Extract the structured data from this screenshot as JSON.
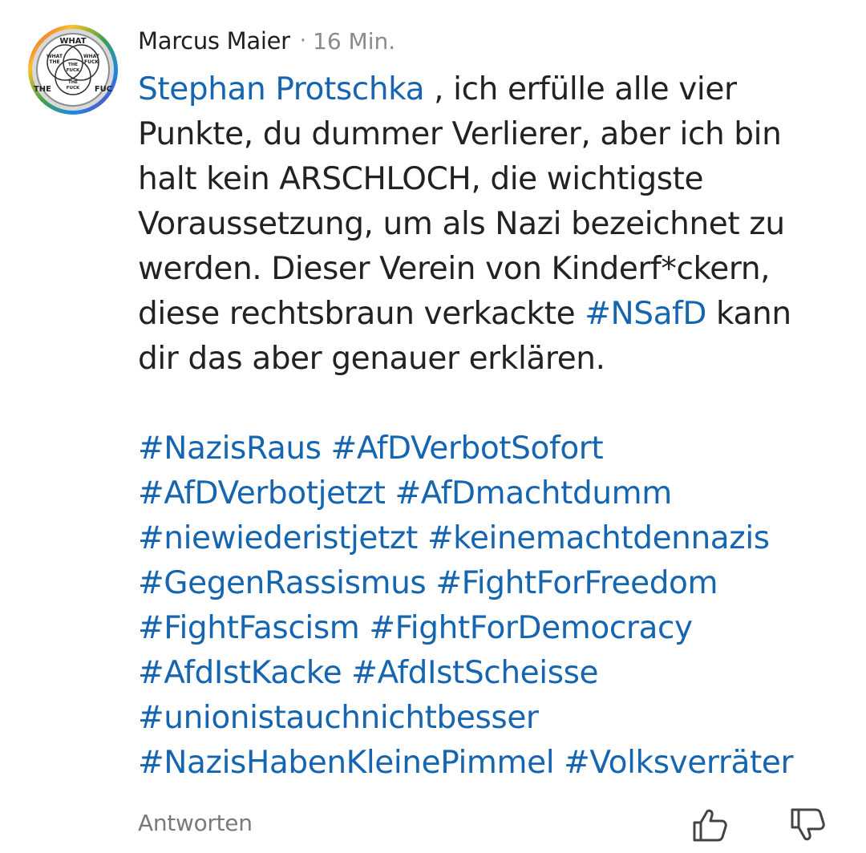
{
  "comment": {
    "author": "Marcus Maier",
    "separator": "·",
    "time": "16 Min.",
    "avatar": {
      "icon": "venn-diagram-avatar",
      "words": [
        "WHAT",
        "WHAT",
        "WHAT",
        "THE",
        "FUCK",
        "THE",
        "FUCK",
        "THE",
        "FUCK",
        "THE",
        "FUC"
      ]
    },
    "mention": "Stephan Protschka",
    "lines": [
      " , ich erfülle alle vier",
      "Punkte, du dummer Verlierer, aber ich bin",
      "halt kein ARSCHLOCH, die wichtigste",
      "Voraussetzung, um als Nazi bezeichnet zu",
      "werden. Dieser Verein von Kinderf*ckern,"
    ],
    "line6_pre": "diese rechtsbraun verkackte ",
    "line6_tag": "#NSafD",
    "line6_post": " kann",
    "line7": "dir das aber genauer erklären.",
    "hashtag_lines": [
      "#NazisRaus #AfDVerbotSofort",
      "#AfDVerbotjetzt #AfDmachtdumm",
      "#niewiederistjetzt #keinemachtdennazis",
      "#GegenRassismus #FightForFreedom",
      "#FightFascism #FightForDemocracy",
      "#AfdIstKacke #AfdIstScheisse",
      "#unionistauchnichtbesser",
      "#NazisHabenKleinePimmel #Volksverräter"
    ],
    "reply_label": "Antworten",
    "like_icon": "thumbs-up-icon",
    "dislike_icon": "thumbs-down-icon",
    "colors": {
      "link": "#1565b0",
      "text": "#222222",
      "muted": "#8a8a8a"
    }
  }
}
